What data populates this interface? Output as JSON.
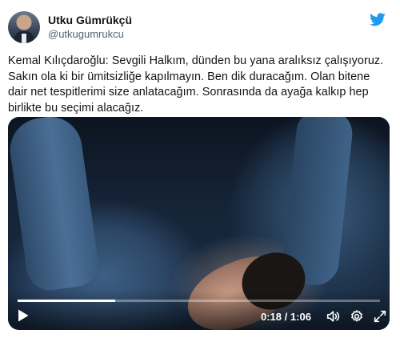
{
  "author": {
    "display_name": "Utku Gümrükçü",
    "handle": "@utkugumrukcu"
  },
  "tweet_text": "Kemal Kılıçdaroğlu: Sevgili Halkım, dünden bu yana aralıksız çalışıyoruz. Sakın ola ki bir ümitsizliğe kapılmayın. Ben dik duracağım. Olan bitene dair net tespitlerimi size anlatacağım. Sonrasında da ayağa kalkıp hep birlikte bu seçimi alacağız.",
  "video": {
    "current_time": "0:18",
    "separator": "/",
    "duration": "1:06",
    "progress_fraction": 0.27
  },
  "icons": {
    "brand": "twitter-bird-icon",
    "play": "play-icon",
    "volume": "volume-icon",
    "settings": "gear-icon",
    "fullscreen": "fullscreen-icon"
  },
  "colors": {
    "brand_blue": "#1d9bf0",
    "text_primary": "#0f1419",
    "text_secondary": "#536471"
  }
}
